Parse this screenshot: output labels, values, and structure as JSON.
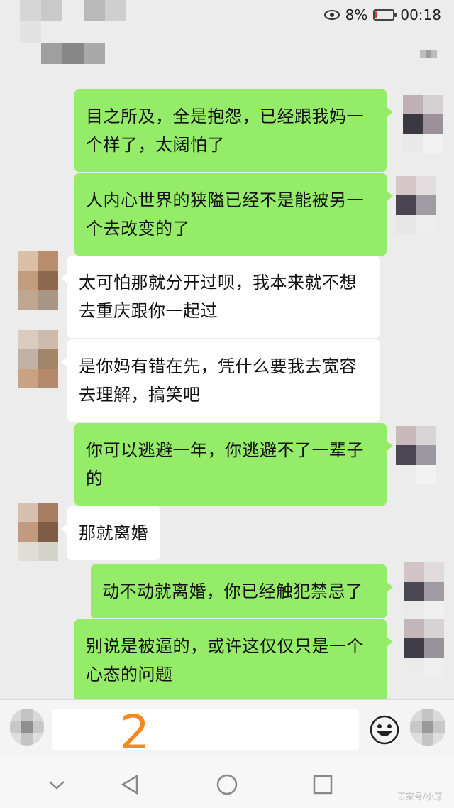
{
  "status_bar": {
    "battery_percent": "8%",
    "time": "00:18",
    "battery_level": 0.08
  },
  "messages": [
    {
      "sender": "me",
      "text": "目之所及，全是抱怨，已经跟我妈一\n个样了，太阔怕了"
    },
    {
      "sender": "me",
      "text": "人内心世界的狭隘已经不是能被另一\n个去改变的了"
    },
    {
      "sender": "them",
      "text": "太可怕那就分开过呗，我本来就不想\n去重庆跟你一起过"
    },
    {
      "sender": "them",
      "text": "是你妈有错在先，凭什么要我去宽容\n去理解，搞笑吧"
    },
    {
      "sender": "me",
      "text": "你可以逃避一年，你逃避不了一辈子\n的"
    },
    {
      "sender": "them",
      "text": "那就离婚"
    },
    {
      "sender": "me",
      "text": "动不动就离婚，你已经触犯禁忌了"
    },
    {
      "sender": "me",
      "text": "别说是被逼的，或许这仅仅只是一个\n心态的问题"
    }
  ],
  "input_bar": {
    "typed_text": "2"
  },
  "nav_bar": {
    "watermark": "百家号/小芽"
  },
  "icons": {
    "status_eye": "eye-icon",
    "battery": "battery-icon",
    "more": "more-icon",
    "voice": "voice-icon",
    "emoji": "emoji-icon",
    "plus": "plus-icon",
    "nav_down": "chevron-down-icon",
    "nav_back": "back-triangle-icon",
    "nav_home": "home-circle-icon",
    "nav_recent": "recent-square-icon"
  },
  "colors": {
    "my_bubble": "#95ec69",
    "their_bubble": "#ffffff",
    "background": "#ececec",
    "typed_text": "#f28a1e"
  }
}
